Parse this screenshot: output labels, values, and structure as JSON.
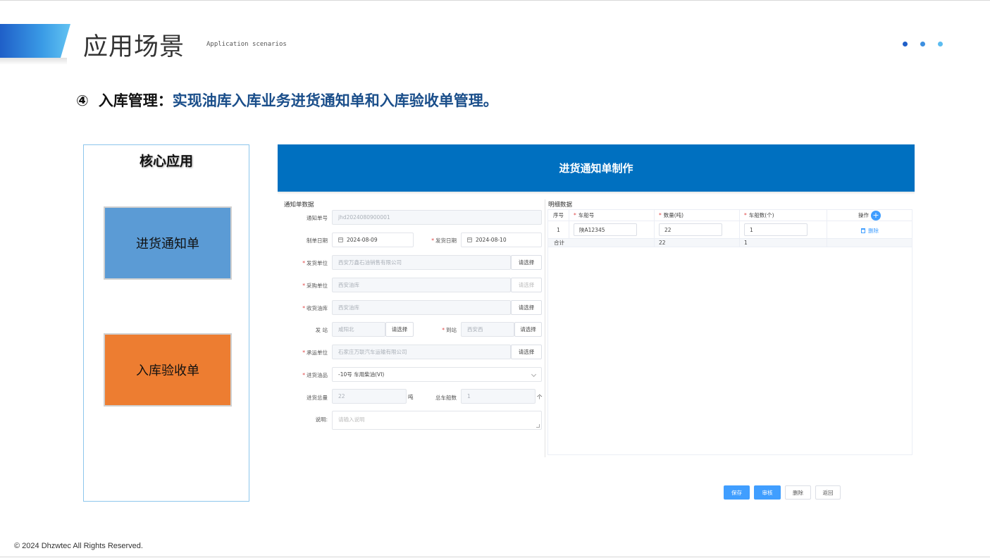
{
  "slide": {
    "title": "应用场景",
    "subtitle": "Application scenarios",
    "headline_number": "④",
    "headline_key": "入库管理：",
    "headline_text": "实现油库入库业务进货通知单和入库验收单管理。",
    "footer": "© 2024  Dhzwtec All Rights Reserved.",
    "colors": {
      "accent_blue": "#0070c0",
      "box_blue": "#5b9bd5",
      "box_orange": "#ed7d31",
      "headline_blue": "#1a4e8a"
    }
  },
  "core_panel": {
    "title": "核心应用",
    "items": [
      "进货通知单",
      "入库验收单"
    ]
  },
  "app": {
    "header_title": "进货通知单制作",
    "left_section_label": "通知单数据",
    "right_section_label": "明细数据",
    "form": {
      "notice_no": {
        "label": "通知单号",
        "value": "jhd2024080900001"
      },
      "create_date": {
        "label": "制单日期",
        "value": "2024-08-09"
      },
      "ship_date": {
        "label": "发货日期",
        "value": "2024-08-10"
      },
      "ship_unit": {
        "label": "发货单位",
        "value": "西安万鑫石油销售有限公司",
        "button": "请选择"
      },
      "purchase_unit": {
        "label": "采购单位",
        "value": "西安油库",
        "button": "请选择"
      },
      "receive_depot": {
        "label": "收货油库",
        "value": "西安油库",
        "button": "请选择"
      },
      "from_station": {
        "label": "发 站",
        "value": "咸阳北",
        "button": "请选择"
      },
      "to_station": {
        "label": "到站",
        "value": "西安西",
        "button": "请选择"
      },
      "carrier": {
        "label": "承运单位",
        "value": "石家庄万联汽车运输有限公司",
        "button": "请选择"
      },
      "oil_product": {
        "label": "进货油品",
        "value": "-10号 车用柴油(VI)"
      },
      "total_qty": {
        "label": "进货总量",
        "value": "22",
        "unit": "吨"
      },
      "total_vehicles": {
        "label": "总车船数",
        "value": "1",
        "unit": "个"
      },
      "remark": {
        "label": "说明:",
        "placeholder": "请输入说明"
      }
    },
    "detail_table": {
      "columns": [
        "序号",
        "车船号",
        "数量(吨)",
        "车船数(个)",
        "操作"
      ],
      "rows": [
        {
          "index": "1",
          "vehicle": "陕A12345",
          "qty": "22",
          "count": "1",
          "action": "删除"
        }
      ],
      "total": {
        "label": "合计",
        "qty": "22",
        "count": "1"
      },
      "add_icon": "plus-icon"
    },
    "actions": [
      "保存",
      "审核",
      "删除",
      "返回"
    ]
  }
}
